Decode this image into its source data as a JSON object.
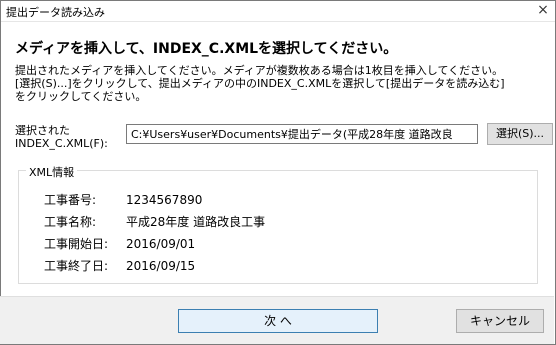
{
  "window": {
    "title": "提出データ読み込み",
    "close_glyph": "×"
  },
  "heading": "メディアを挿入して、INDEX_C.XMLを選択してください。",
  "description": [
    "提出されたメディアを挿入してください。メディアが複数枚ある場合は1枚目を挿入してください。",
    "[選択(S)...]をクリックして、提出メディアの中のINDEX_C.XMLを選択して[提出データを読み込む]",
    "をクリックしてください。"
  ],
  "field": {
    "label_lines": [
      "選択された",
      "INDEX_C.XML(F):"
    ],
    "value": "C:¥Users¥user¥Documents¥提出データ(平成28年度 道路改良",
    "select_button": "選択(S)..."
  },
  "xml_info": {
    "group_title": "XML情報",
    "rows": [
      {
        "key": "工事番号:",
        "value": "1234567890"
      },
      {
        "key": "工事名称:",
        "value": "平成28年度 道路改良工事"
      },
      {
        "key": "工事開始日:",
        "value": "2016/09/01"
      },
      {
        "key": "工事終了日:",
        "value": "2016/09/15"
      }
    ]
  },
  "buttons": {
    "next": "次 へ",
    "cancel": "キャンセル"
  }
}
